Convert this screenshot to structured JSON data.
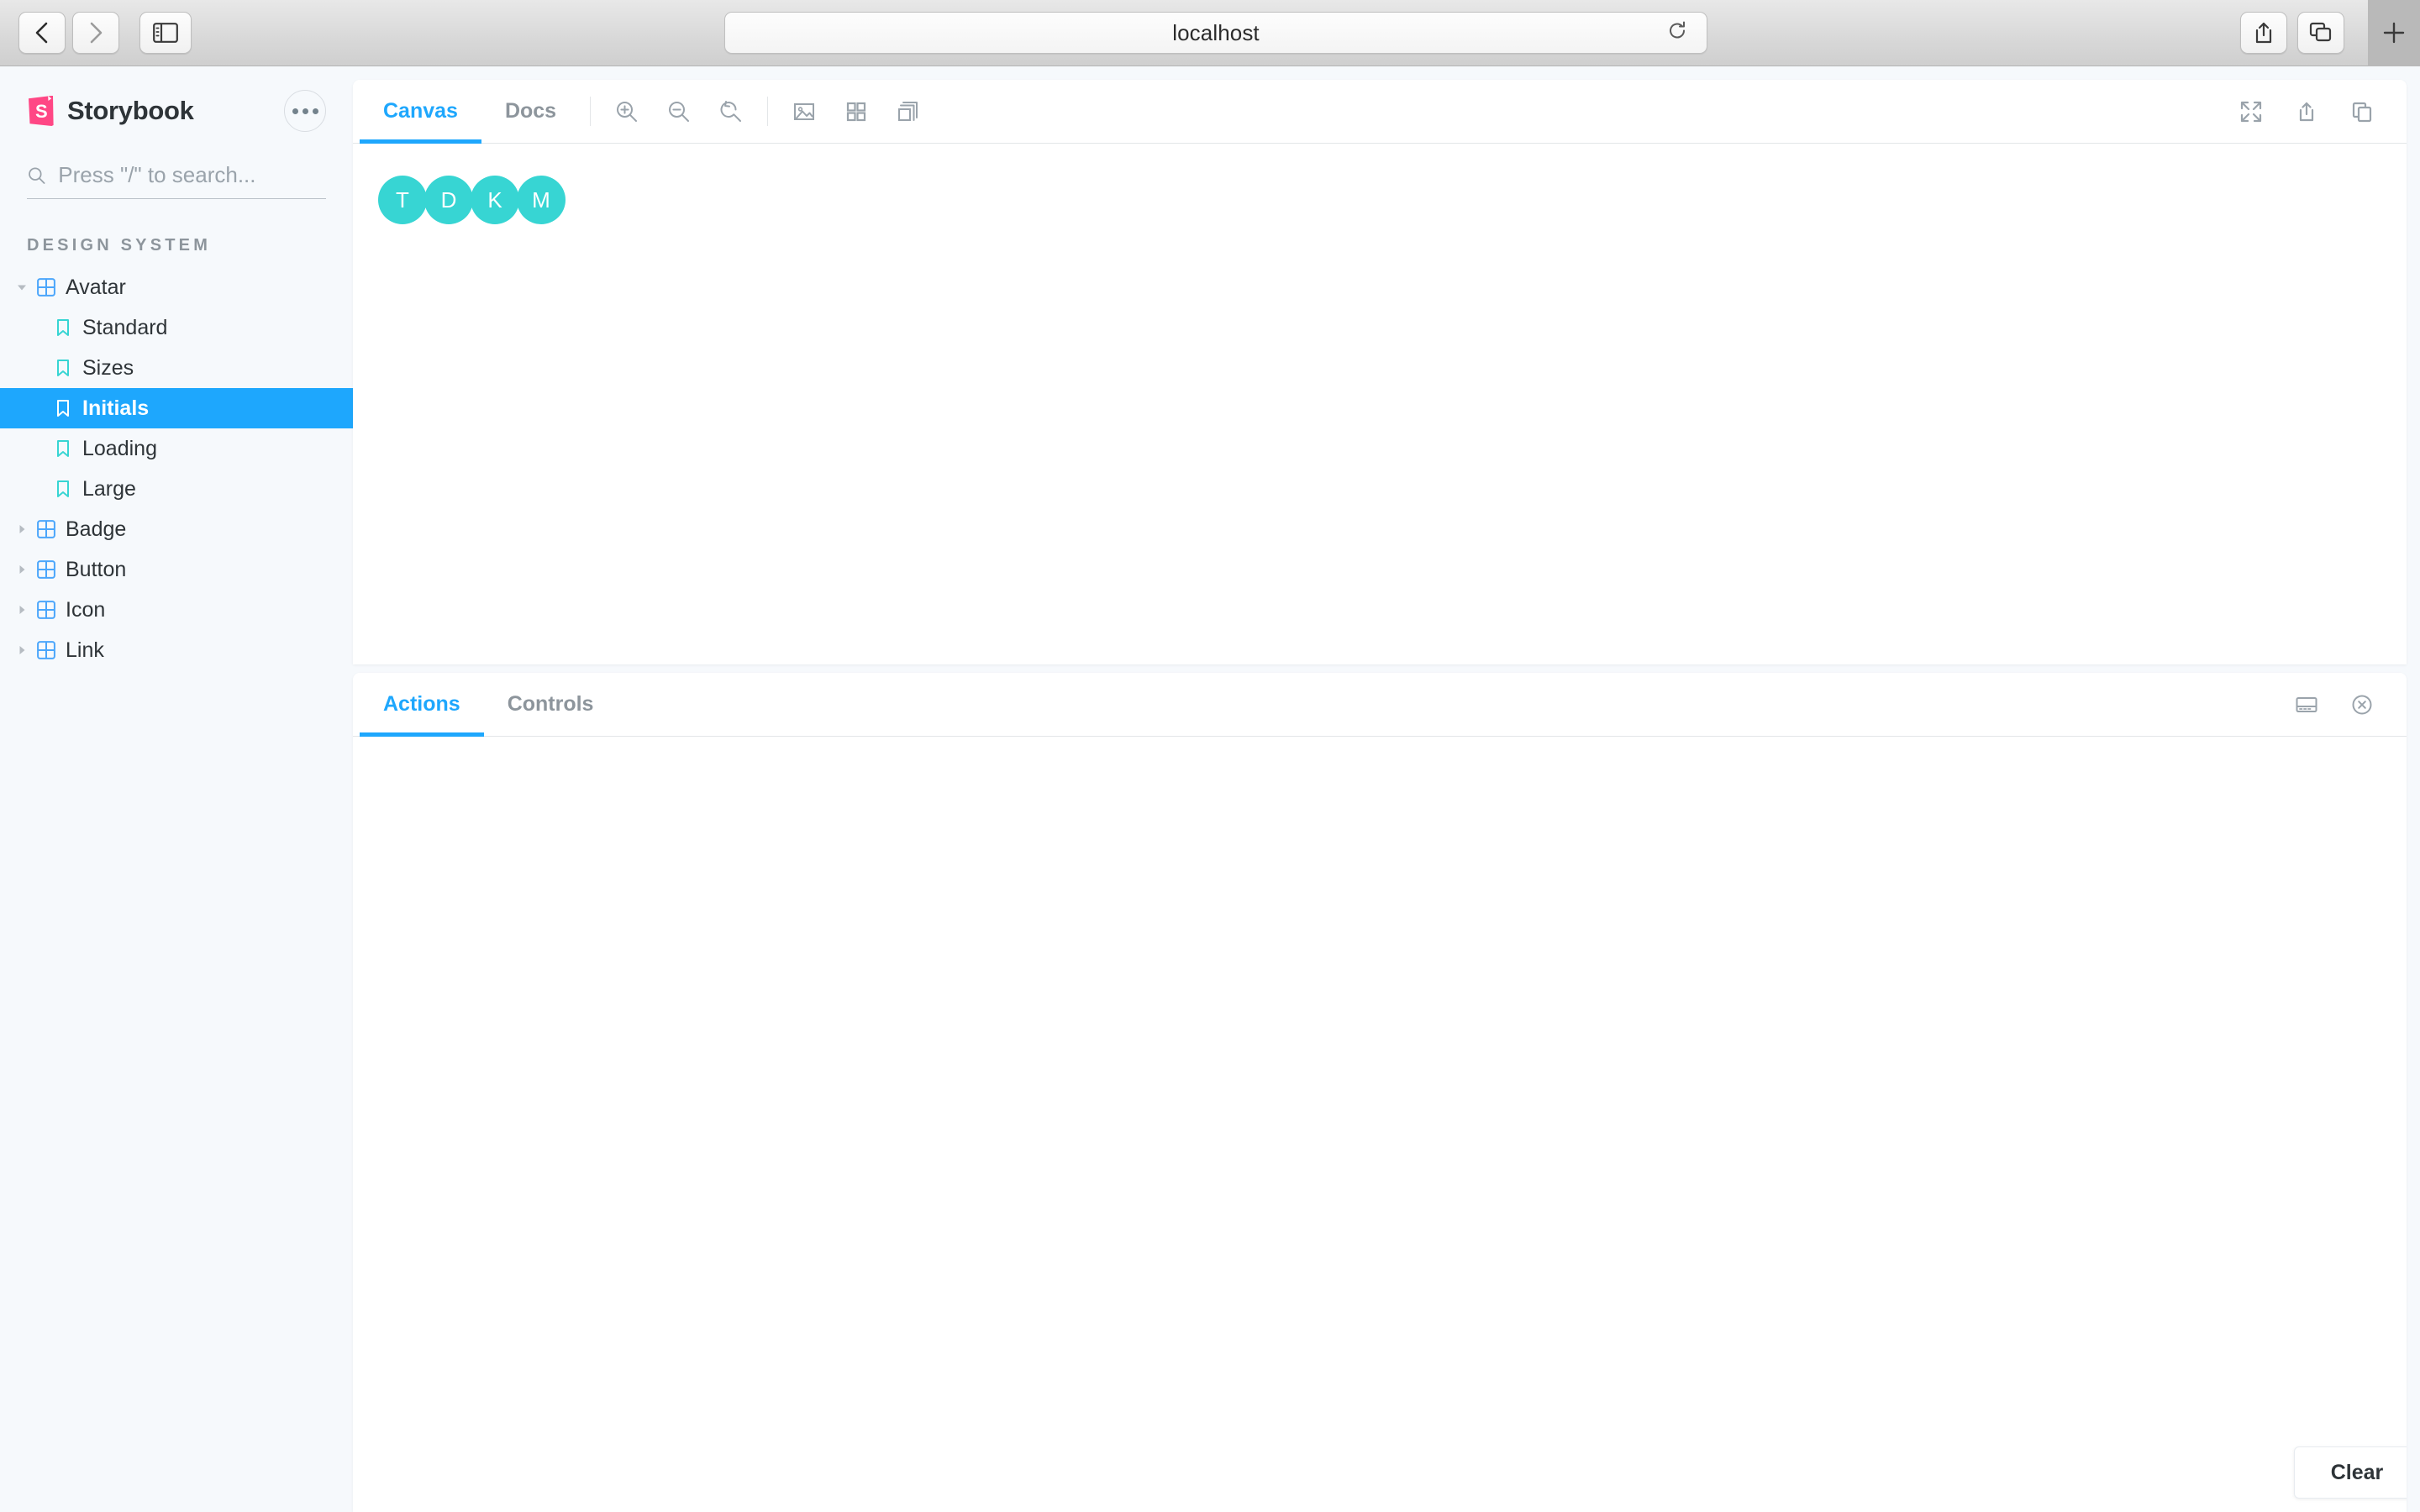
{
  "browser": {
    "back_label": "Back",
    "forward_label": "Forward",
    "sidebar_toggle_label": "Show Sidebar",
    "url": "localhost",
    "reload_label": "Reload",
    "share_label": "Share",
    "tabs_label": "Tab Overview",
    "new_tab_label": "+"
  },
  "sidebar": {
    "brand": "Storybook",
    "menu_label": "•••",
    "search": {
      "placeholder": "Press \"/\" to search...",
      "value": ""
    },
    "section_title": "DESIGN SYSTEM",
    "tree": [
      {
        "label": "Avatar",
        "type": "component",
        "expanded": true,
        "selected": false,
        "depth": 0
      },
      {
        "label": "Standard",
        "type": "story",
        "expanded": false,
        "selected": false,
        "depth": 1
      },
      {
        "label": "Sizes",
        "type": "story",
        "expanded": false,
        "selected": false,
        "depth": 1
      },
      {
        "label": "Initials",
        "type": "story",
        "expanded": false,
        "selected": true,
        "depth": 1
      },
      {
        "label": "Loading",
        "type": "story",
        "expanded": false,
        "selected": false,
        "depth": 1
      },
      {
        "label": "Large",
        "type": "story",
        "expanded": false,
        "selected": false,
        "depth": 1
      },
      {
        "label": "Badge",
        "type": "component",
        "expanded": false,
        "selected": false,
        "depth": 0
      },
      {
        "label": "Button",
        "type": "component",
        "expanded": false,
        "selected": false,
        "depth": 0
      },
      {
        "label": "Icon",
        "type": "component",
        "expanded": false,
        "selected": false,
        "depth": 0
      },
      {
        "label": "Link",
        "type": "component",
        "expanded": false,
        "selected": false,
        "depth": 0
      }
    ]
  },
  "canvas": {
    "tabs": [
      {
        "label": "Canvas",
        "active": true
      },
      {
        "label": "Docs",
        "active": false
      }
    ],
    "tools": [
      {
        "name": "zoom-in-icon",
        "label": "Zoom in"
      },
      {
        "name": "zoom-out-icon",
        "label": "Zoom out"
      },
      {
        "name": "zoom-reset-icon",
        "label": "Reset zoom"
      },
      {
        "name": "background-icon",
        "label": "Change background"
      },
      {
        "name": "grid-icon",
        "label": "Apply a grid to the preview"
      },
      {
        "name": "measure-icon",
        "label": "Enable measure"
      }
    ],
    "right_tools": [
      {
        "name": "fullscreen-icon",
        "label": "Go full screen"
      },
      {
        "name": "open-new-icon",
        "label": "Open canvas in new tab"
      },
      {
        "name": "copy-icon",
        "label": "Copy canvas link"
      }
    ],
    "story": {
      "component": "Avatar",
      "story_name": "Initials",
      "avatar_color": "#37D5D3",
      "avatars": [
        {
          "initials": "T"
        },
        {
          "initials": "D"
        },
        {
          "initials": "K"
        },
        {
          "initials": "M"
        }
      ]
    }
  },
  "addons": {
    "tabs": [
      {
        "label": "Actions",
        "active": true
      },
      {
        "label": "Controls",
        "active": false
      }
    ],
    "right_tools": [
      {
        "name": "panel-position-icon",
        "label": "Change addon orientation"
      },
      {
        "name": "close-panel-icon",
        "label": "Hide addons"
      }
    ],
    "clear_label": "Clear",
    "log_entries": []
  },
  "colors": {
    "accent_blue": "#1EA7FD",
    "brand_pink": "#FF4785",
    "teal": "#37D5D3",
    "app_bg": "#F6F9FC",
    "text": "#2E3438",
    "muted": "#8D959C"
  }
}
